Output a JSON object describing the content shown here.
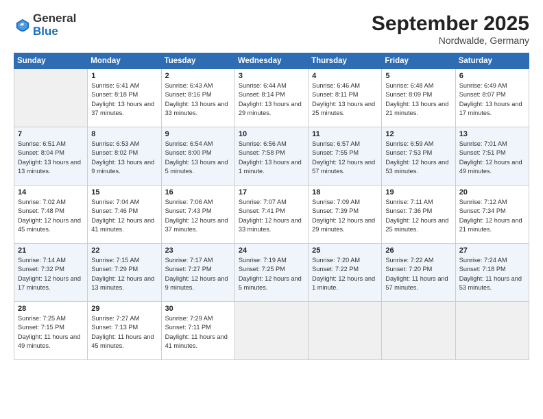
{
  "header": {
    "logo_general": "General",
    "logo_blue": "Blue",
    "month": "September 2025",
    "location": "Nordwalde, Germany"
  },
  "days_of_week": [
    "Sunday",
    "Monday",
    "Tuesday",
    "Wednesday",
    "Thursday",
    "Friday",
    "Saturday"
  ],
  "weeks": [
    [
      {
        "day": "",
        "empty": true
      },
      {
        "day": "1",
        "sunrise": "Sunrise: 6:41 AM",
        "sunset": "Sunset: 8:18 PM",
        "daylight": "Daylight: 13 hours and 37 minutes."
      },
      {
        "day": "2",
        "sunrise": "Sunrise: 6:43 AM",
        "sunset": "Sunset: 8:16 PM",
        "daylight": "Daylight: 13 hours and 33 minutes."
      },
      {
        "day": "3",
        "sunrise": "Sunrise: 6:44 AM",
        "sunset": "Sunset: 8:14 PM",
        "daylight": "Daylight: 13 hours and 29 minutes."
      },
      {
        "day": "4",
        "sunrise": "Sunrise: 6:46 AM",
        "sunset": "Sunset: 8:11 PM",
        "daylight": "Daylight: 13 hours and 25 minutes."
      },
      {
        "day": "5",
        "sunrise": "Sunrise: 6:48 AM",
        "sunset": "Sunset: 8:09 PM",
        "daylight": "Daylight: 13 hours and 21 minutes."
      },
      {
        "day": "6",
        "sunrise": "Sunrise: 6:49 AM",
        "sunset": "Sunset: 8:07 PM",
        "daylight": "Daylight: 13 hours and 17 minutes."
      }
    ],
    [
      {
        "day": "7",
        "sunrise": "Sunrise: 6:51 AM",
        "sunset": "Sunset: 8:04 PM",
        "daylight": "Daylight: 13 hours and 13 minutes."
      },
      {
        "day": "8",
        "sunrise": "Sunrise: 6:53 AM",
        "sunset": "Sunset: 8:02 PM",
        "daylight": "Daylight: 13 hours and 9 minutes."
      },
      {
        "day": "9",
        "sunrise": "Sunrise: 6:54 AM",
        "sunset": "Sunset: 8:00 PM",
        "daylight": "Daylight: 13 hours and 5 minutes."
      },
      {
        "day": "10",
        "sunrise": "Sunrise: 6:56 AM",
        "sunset": "Sunset: 7:58 PM",
        "daylight": "Daylight: 13 hours and 1 minute."
      },
      {
        "day": "11",
        "sunrise": "Sunrise: 6:57 AM",
        "sunset": "Sunset: 7:55 PM",
        "daylight": "Daylight: 12 hours and 57 minutes."
      },
      {
        "day": "12",
        "sunrise": "Sunrise: 6:59 AM",
        "sunset": "Sunset: 7:53 PM",
        "daylight": "Daylight: 12 hours and 53 minutes."
      },
      {
        "day": "13",
        "sunrise": "Sunrise: 7:01 AM",
        "sunset": "Sunset: 7:51 PM",
        "daylight": "Daylight: 12 hours and 49 minutes."
      }
    ],
    [
      {
        "day": "14",
        "sunrise": "Sunrise: 7:02 AM",
        "sunset": "Sunset: 7:48 PM",
        "daylight": "Daylight: 12 hours and 45 minutes."
      },
      {
        "day": "15",
        "sunrise": "Sunrise: 7:04 AM",
        "sunset": "Sunset: 7:46 PM",
        "daylight": "Daylight: 12 hours and 41 minutes."
      },
      {
        "day": "16",
        "sunrise": "Sunrise: 7:06 AM",
        "sunset": "Sunset: 7:43 PM",
        "daylight": "Daylight: 12 hours and 37 minutes."
      },
      {
        "day": "17",
        "sunrise": "Sunrise: 7:07 AM",
        "sunset": "Sunset: 7:41 PM",
        "daylight": "Daylight: 12 hours and 33 minutes."
      },
      {
        "day": "18",
        "sunrise": "Sunrise: 7:09 AM",
        "sunset": "Sunset: 7:39 PM",
        "daylight": "Daylight: 12 hours and 29 minutes."
      },
      {
        "day": "19",
        "sunrise": "Sunrise: 7:11 AM",
        "sunset": "Sunset: 7:36 PM",
        "daylight": "Daylight: 12 hours and 25 minutes."
      },
      {
        "day": "20",
        "sunrise": "Sunrise: 7:12 AM",
        "sunset": "Sunset: 7:34 PM",
        "daylight": "Daylight: 12 hours and 21 minutes."
      }
    ],
    [
      {
        "day": "21",
        "sunrise": "Sunrise: 7:14 AM",
        "sunset": "Sunset: 7:32 PM",
        "daylight": "Daylight: 12 hours and 17 minutes."
      },
      {
        "day": "22",
        "sunrise": "Sunrise: 7:15 AM",
        "sunset": "Sunset: 7:29 PM",
        "daylight": "Daylight: 12 hours and 13 minutes."
      },
      {
        "day": "23",
        "sunrise": "Sunrise: 7:17 AM",
        "sunset": "Sunset: 7:27 PM",
        "daylight": "Daylight: 12 hours and 9 minutes."
      },
      {
        "day": "24",
        "sunrise": "Sunrise: 7:19 AM",
        "sunset": "Sunset: 7:25 PM",
        "daylight": "Daylight: 12 hours and 5 minutes."
      },
      {
        "day": "25",
        "sunrise": "Sunrise: 7:20 AM",
        "sunset": "Sunset: 7:22 PM",
        "daylight": "Daylight: 12 hours and 1 minute."
      },
      {
        "day": "26",
        "sunrise": "Sunrise: 7:22 AM",
        "sunset": "Sunset: 7:20 PM",
        "daylight": "Daylight: 11 hours and 57 minutes."
      },
      {
        "day": "27",
        "sunrise": "Sunrise: 7:24 AM",
        "sunset": "Sunset: 7:18 PM",
        "daylight": "Daylight: 11 hours and 53 minutes."
      }
    ],
    [
      {
        "day": "28",
        "sunrise": "Sunrise: 7:25 AM",
        "sunset": "Sunset: 7:15 PM",
        "daylight": "Daylight: 11 hours and 49 minutes."
      },
      {
        "day": "29",
        "sunrise": "Sunrise: 7:27 AM",
        "sunset": "Sunset: 7:13 PM",
        "daylight": "Daylight: 11 hours and 45 minutes."
      },
      {
        "day": "30",
        "sunrise": "Sunrise: 7:29 AM",
        "sunset": "Sunset: 7:11 PM",
        "daylight": "Daylight: 11 hours and 41 minutes."
      },
      {
        "day": "",
        "empty": true
      },
      {
        "day": "",
        "empty": true
      },
      {
        "day": "",
        "empty": true
      },
      {
        "day": "",
        "empty": true
      }
    ]
  ]
}
